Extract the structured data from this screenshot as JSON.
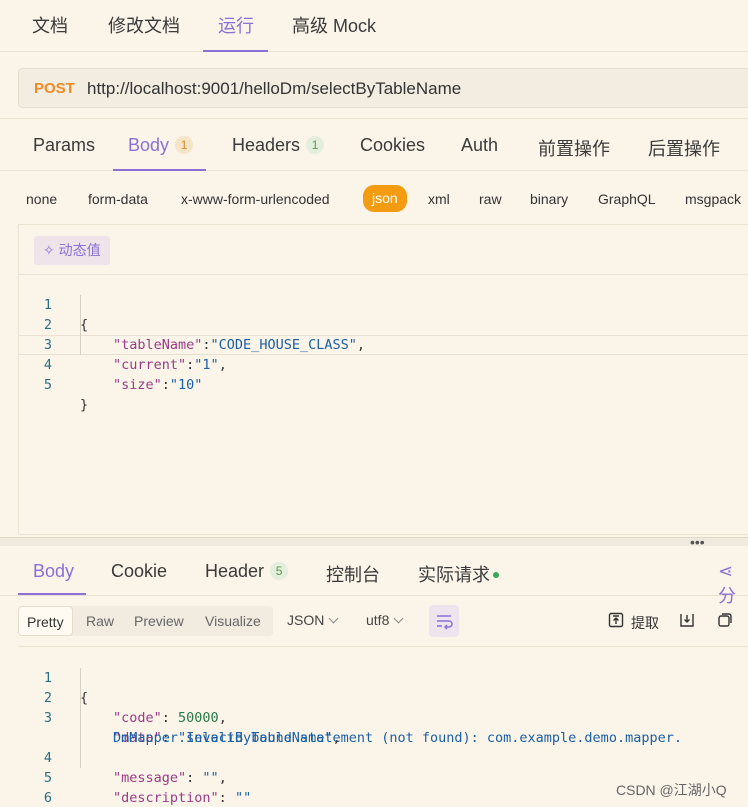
{
  "top_tabs": [
    "文档",
    "修改文档",
    "运行",
    "高级 Mock"
  ],
  "request": {
    "method": "POST",
    "url": "http://localhost:9001/helloDm/selectByTableName"
  },
  "request_tabs": {
    "params": "Params",
    "body": "Body",
    "body_count": "1",
    "headers": "Headers",
    "headers_count": "1",
    "cookies": "Cookies",
    "auth": "Auth",
    "pre_ops": "前置操作",
    "post_ops": "后置操作"
  },
  "body_types": [
    "none",
    "form-data",
    "x-www-form-urlencoded",
    "json",
    "xml",
    "raw",
    "binary",
    "GraphQL",
    "msgpack"
  ],
  "dynamic_value_label": "动态值",
  "request_body": [
    {
      "ln": "1",
      "text": "{"
    },
    {
      "ln": "2",
      "key": "\"tableName\"",
      "value": "\"CODE_HOUSE_CLASS\"",
      "tail": ","
    },
    {
      "ln": "3",
      "key": "\"current\"",
      "value": "\"1\"",
      "tail": ","
    },
    {
      "ln": "4",
      "key": "\"size\"",
      "value": "\"10\"",
      "tail": ""
    },
    {
      "ln": "5",
      "text": "}"
    }
  ],
  "response_tabs": {
    "body": "Body",
    "cookie": "Cookie",
    "header": "Header",
    "header_count": "5",
    "console": "控制台",
    "actual_request": "实际请求",
    "share": "分"
  },
  "response_views": [
    "Pretty",
    "Raw",
    "Preview",
    "Visualize"
  ],
  "response_format": "JSON",
  "response_encoding": "utf8",
  "extract_label": "提取",
  "response_body": {
    "l1": "{",
    "code_key": "\"code\"",
    "code_val": "50000",
    "data_key": "\"data\"",
    "data_val1": "\"Invalid bound statement (not found): com.example.demo.mapper.",
    "data_val2": "DmMapper.selectByTableName\"",
    "message_key": "\"message\"",
    "message_val": "\"\"",
    "description_key": "\"description\"",
    "description_val": "\"\"",
    "l6": "}"
  },
  "line_numbers_resp": [
    "1",
    "2",
    "3",
    "4",
    "5",
    "6"
  ],
  "watermark": "CSDN @江湖小Q",
  "colors": {
    "accent": "#8b6fd6",
    "method": "#f08a24",
    "json_pill": "#f39c12"
  }
}
